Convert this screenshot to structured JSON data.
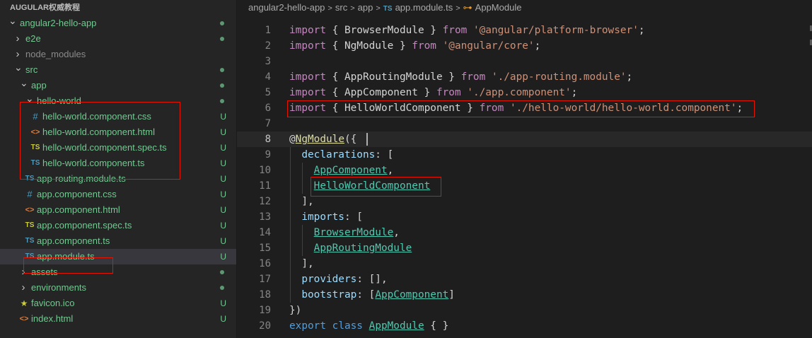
{
  "explorer": {
    "title": "AUGULAR权威教程",
    "items": [
      {
        "label": "angular2-hello-app",
        "type": "folder-open",
        "depth": 0,
        "status": "dot",
        "color": "green"
      },
      {
        "label": "e2e",
        "type": "folder-closed",
        "depth": 1,
        "status": "dot",
        "color": "green"
      },
      {
        "label": "node_modules",
        "type": "folder-closed",
        "depth": 1,
        "status": "",
        "color": "gray"
      },
      {
        "label": "src",
        "type": "folder-open",
        "depth": 1,
        "status": "dot",
        "color": "green"
      },
      {
        "label": "app",
        "type": "folder-open",
        "depth": 2,
        "status": "dot",
        "color": "green"
      },
      {
        "label": "hello-world",
        "type": "folder-open",
        "depth": 3,
        "status": "dot",
        "color": "green"
      },
      {
        "label": "hello-world.component.css",
        "type": "css",
        "depth": 4,
        "status": "U",
        "color": "green"
      },
      {
        "label": "hello-world.component.html",
        "type": "html",
        "depth": 4,
        "status": "U",
        "color": "green"
      },
      {
        "label": "hello-world.component.spec.ts",
        "type": "spec",
        "depth": 4,
        "status": "U",
        "color": "green"
      },
      {
        "label": "hello-world.component.ts",
        "type": "ts",
        "depth": 4,
        "status": "U",
        "color": "green"
      },
      {
        "label": "app-routing.module.ts",
        "type": "ts",
        "depth": 3,
        "status": "U",
        "color": "green"
      },
      {
        "label": "app.component.css",
        "type": "css",
        "depth": 3,
        "status": "U",
        "color": "green"
      },
      {
        "label": "app.component.html",
        "type": "html",
        "depth": 3,
        "status": "U",
        "color": "green"
      },
      {
        "label": "app.component.spec.ts",
        "type": "spec",
        "depth": 3,
        "status": "U",
        "color": "green"
      },
      {
        "label": "app.component.ts",
        "type": "ts",
        "depth": 3,
        "status": "U",
        "color": "green"
      },
      {
        "label": "app.module.ts",
        "type": "ts",
        "depth": 3,
        "status": "U",
        "color": "green",
        "selected": true
      },
      {
        "label": "assets",
        "type": "folder-closed",
        "depth": 2,
        "status": "dot",
        "color": "green"
      },
      {
        "label": "environments",
        "type": "folder-closed",
        "depth": 2,
        "status": "dot",
        "color": "green"
      },
      {
        "label": "favicon.ico",
        "type": "star",
        "depth": 2,
        "status": "U",
        "color": "green"
      },
      {
        "label": "index.html",
        "type": "html",
        "depth": 2,
        "status": "U",
        "color": "green"
      }
    ],
    "icon_glyphs": {
      "ts": "TS",
      "spec": "TS",
      "css": "#",
      "html": "<>",
      "star": "★"
    }
  },
  "breadcrumb": {
    "parts": [
      "angular2-hello-app",
      "src",
      "app"
    ],
    "file_badge": "TS",
    "file": "app.module.ts",
    "symbol": "AppModule",
    "separator": ">"
  },
  "editor": {
    "current_line": 8,
    "lines": [
      {
        "n": "1",
        "tokens": [
          [
            "kw",
            "import"
          ],
          [
            "p",
            " { "
          ],
          [
            "p",
            "BrowserModule"
          ],
          [
            "p",
            " } "
          ],
          [
            "kw",
            "from"
          ],
          [
            "p",
            " "
          ],
          [
            "str",
            "'@angular/platform-browser'"
          ],
          [
            "p",
            ";"
          ]
        ]
      },
      {
        "n": "2",
        "tokens": [
          [
            "kw",
            "import"
          ],
          [
            "p",
            " { "
          ],
          [
            "p",
            "NgModule"
          ],
          [
            "p",
            " } "
          ],
          [
            "kw",
            "from"
          ],
          [
            "p",
            " "
          ],
          [
            "str",
            "'@angular/core'"
          ],
          [
            "p",
            ";"
          ]
        ]
      },
      {
        "n": "3",
        "tokens": []
      },
      {
        "n": "4",
        "tokens": [
          [
            "kw",
            "import"
          ],
          [
            "p",
            " { "
          ],
          [
            "p",
            "AppRoutingModule"
          ],
          [
            "p",
            " } "
          ],
          [
            "kw",
            "from"
          ],
          [
            "p",
            " "
          ],
          [
            "str",
            "'./app-routing.module'"
          ],
          [
            "p",
            ";"
          ]
        ]
      },
      {
        "n": "5",
        "tokens": [
          [
            "kw",
            "import"
          ],
          [
            "p",
            " { "
          ],
          [
            "p",
            "AppComponent"
          ],
          [
            "p",
            " } "
          ],
          [
            "kw",
            "from"
          ],
          [
            "p",
            " "
          ],
          [
            "str",
            "'./app.component'"
          ],
          [
            "p",
            ";"
          ]
        ]
      },
      {
        "n": "6",
        "tokens": [
          [
            "kw",
            "import"
          ],
          [
            "p",
            " { "
          ],
          [
            "p",
            "HelloWorldComponent"
          ],
          [
            "p",
            " } "
          ],
          [
            "kw",
            "from"
          ],
          [
            "p",
            " "
          ],
          [
            "str",
            "'./hello-world/hello-world.component'"
          ],
          [
            "p",
            ";"
          ]
        ]
      },
      {
        "n": "7",
        "tokens": []
      },
      {
        "n": "8",
        "tokens": [
          [
            "p",
            "@"
          ],
          [
            "dec ulw",
            "NgModule"
          ],
          [
            "p",
            "({"
          ]
        ]
      },
      {
        "n": "9",
        "tokens": [
          [
            "p",
            "  "
          ],
          [
            "prop",
            "declarations"
          ],
          [
            "p",
            ": ["
          ]
        ]
      },
      {
        "n": "10",
        "tokens": [
          [
            "p",
            "    "
          ],
          [
            "cls ul",
            "AppComponent"
          ],
          [
            "p",
            ","
          ]
        ]
      },
      {
        "n": "11",
        "tokens": [
          [
            "p",
            "    "
          ],
          [
            "cls ul",
            "HelloWorldComponent"
          ]
        ]
      },
      {
        "n": "12",
        "tokens": [
          [
            "p",
            "  ],"
          ]
        ]
      },
      {
        "n": "13",
        "tokens": [
          [
            "p",
            "  "
          ],
          [
            "prop",
            "imports"
          ],
          [
            "p",
            ": ["
          ]
        ]
      },
      {
        "n": "14",
        "tokens": [
          [
            "p",
            "    "
          ],
          [
            "cls ul",
            "BrowserModule"
          ],
          [
            "p",
            ","
          ]
        ]
      },
      {
        "n": "15",
        "tokens": [
          [
            "p",
            "    "
          ],
          [
            "cls ul",
            "AppRoutingModule"
          ]
        ]
      },
      {
        "n": "16",
        "tokens": [
          [
            "p",
            "  ],"
          ]
        ]
      },
      {
        "n": "17",
        "tokens": [
          [
            "p",
            "  "
          ],
          [
            "prop",
            "providers"
          ],
          [
            "p",
            ": [],"
          ]
        ]
      },
      {
        "n": "18",
        "tokens": [
          [
            "p",
            "  "
          ],
          [
            "prop",
            "bootstrap"
          ],
          [
            "p",
            ": ["
          ],
          [
            "cls ul",
            "AppComponent"
          ],
          [
            "p",
            "]"
          ]
        ]
      },
      {
        "n": "19",
        "tokens": [
          [
            "p",
            "})"
          ]
        ]
      },
      {
        "n": "20",
        "tokens": [
          [
            "kw2",
            "export"
          ],
          [
            "p",
            " "
          ],
          [
            "kw2",
            "class"
          ],
          [
            "p",
            " "
          ],
          [
            "cls ul",
            "AppModule"
          ],
          [
            "p",
            " { }"
          ]
        ]
      }
    ]
  },
  "colors": {
    "git_untracked": "#73c991",
    "highlight_box": "#e51400",
    "editor_bg": "#1e1e1e",
    "sidebar_bg": "#252526"
  }
}
